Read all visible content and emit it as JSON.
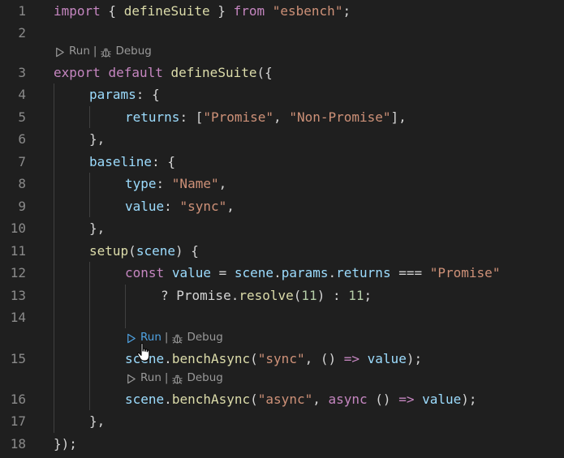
{
  "editor": {
    "lines": [
      {
        "num": "1",
        "tokens": [
          [
            "kw",
            "import"
          ],
          [
            "plain",
            " { "
          ],
          [
            "fn",
            "defineSuite"
          ],
          [
            "plain",
            " } "
          ],
          [
            "kw",
            "from"
          ],
          [
            "plain",
            " "
          ],
          [
            "str",
            "\"esbench\""
          ],
          [
            "plain",
            ";"
          ]
        ]
      },
      {
        "num": "2",
        "tokens": []
      },
      {
        "num": "3",
        "tokens": [
          [
            "kw",
            "export"
          ],
          [
            "plain",
            " "
          ],
          [
            "kw",
            "default"
          ],
          [
            "plain",
            " "
          ],
          [
            "fn",
            "defineSuite"
          ],
          [
            "plain",
            "({"
          ]
        ]
      },
      {
        "num": "4",
        "tokens": [
          [
            "prop",
            "params"
          ],
          [
            "plain",
            ": {"
          ]
        ]
      },
      {
        "num": "5",
        "tokens": [
          [
            "prop",
            "returns"
          ],
          [
            "plain",
            ": ["
          ],
          [
            "str",
            "\"Promise\""
          ],
          [
            "plain",
            ", "
          ],
          [
            "str",
            "\"Non-Promise\""
          ],
          [
            "plain",
            "],"
          ]
        ]
      },
      {
        "num": "6",
        "tokens": [
          [
            "plain",
            "},"
          ]
        ]
      },
      {
        "num": "7",
        "tokens": [
          [
            "prop",
            "baseline"
          ],
          [
            "plain",
            ": {"
          ]
        ]
      },
      {
        "num": "8",
        "tokens": [
          [
            "prop",
            "type"
          ],
          [
            "plain",
            ": "
          ],
          [
            "str",
            "\"Name\""
          ],
          [
            "plain",
            ","
          ]
        ]
      },
      {
        "num": "9",
        "tokens": [
          [
            "prop",
            "value"
          ],
          [
            "plain",
            ": "
          ],
          [
            "str",
            "\"sync\""
          ],
          [
            "plain",
            ","
          ]
        ]
      },
      {
        "num": "10",
        "tokens": [
          [
            "plain",
            "},"
          ]
        ]
      },
      {
        "num": "11",
        "tokens": [
          [
            "fn",
            "setup"
          ],
          [
            "plain",
            "("
          ],
          [
            "prop",
            "scene"
          ],
          [
            "plain",
            ") {"
          ]
        ]
      },
      {
        "num": "12",
        "tokens": [
          [
            "kw",
            "const"
          ],
          [
            "plain",
            " "
          ],
          [
            "prop",
            "value"
          ],
          [
            "plain",
            " = "
          ],
          [
            "prop",
            "scene"
          ],
          [
            "plain",
            "."
          ],
          [
            "prop",
            "params"
          ],
          [
            "plain",
            "."
          ],
          [
            "prop",
            "returns"
          ],
          [
            "plain",
            " === "
          ],
          [
            "str",
            "\"Promise\""
          ]
        ]
      },
      {
        "num": "13",
        "tokens": [
          [
            "plain",
            "? "
          ],
          [
            "plain",
            "Promise"
          ],
          [
            "plain",
            "."
          ],
          [
            "fn",
            "resolve"
          ],
          [
            "plain",
            "("
          ],
          [
            "num",
            "11"
          ],
          [
            "plain",
            ") : "
          ],
          [
            "num",
            "11"
          ],
          [
            "plain",
            ";"
          ]
        ]
      },
      {
        "num": "14",
        "tokens": []
      },
      {
        "num": "15",
        "tokens": [
          [
            "prop",
            "scene"
          ],
          [
            "plain",
            "."
          ],
          [
            "fn",
            "benchAsync"
          ],
          [
            "plain",
            "("
          ],
          [
            "str",
            "\"sync\""
          ],
          [
            "plain",
            ", () "
          ],
          [
            "kw",
            "=>"
          ],
          [
            "plain",
            " "
          ],
          [
            "prop",
            "value"
          ],
          [
            "plain",
            ");"
          ]
        ]
      },
      {
        "num": "16",
        "tokens": [
          [
            "prop",
            "scene"
          ],
          [
            "plain",
            "."
          ],
          [
            "fn",
            "benchAsync"
          ],
          [
            "plain",
            "("
          ],
          [
            "str",
            "\"async\""
          ],
          [
            "plain",
            ", "
          ],
          [
            "kw",
            "async"
          ],
          [
            "plain",
            " () "
          ],
          [
            "kw",
            "=>"
          ],
          [
            "plain",
            " "
          ],
          [
            "prop",
            "value"
          ],
          [
            "plain",
            ");"
          ]
        ]
      },
      {
        "num": "17",
        "tokens": [
          [
            "plain",
            "},"
          ]
        ]
      },
      {
        "num": "18",
        "tokens": [
          [
            "plain",
            "});"
          ]
        ]
      }
    ],
    "codelens": {
      "run_label": "Run",
      "separator": "|",
      "debug_label": "Debug",
      "run_icon": "play-icon",
      "debug_icon": "bug-icon",
      "hover_color": "#4fa3e3"
    }
  }
}
